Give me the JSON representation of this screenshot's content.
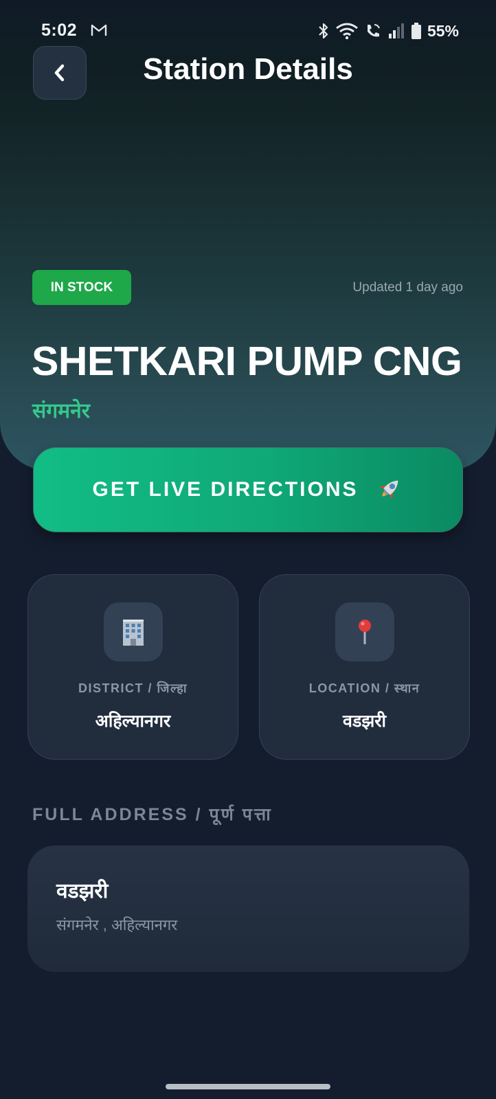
{
  "status_bar": {
    "time": "5:02",
    "battery": "55%",
    "icons": [
      "gmail-icon",
      "bluetooth-icon",
      "wifi-icon",
      "wifi-calling-icon",
      "cell-signal-icon",
      "battery-icon"
    ]
  },
  "header": {
    "back_icon": "chevron-left-icon",
    "title": "Station Details"
  },
  "station": {
    "stock_status": "IN STOCK",
    "updated": "Updated 1 day ago",
    "name": "SHETKARI PUMP CNG",
    "city": "संगमनेर"
  },
  "directions_button": {
    "label": "GET LIVE DIRECTIONS",
    "icon": "rocket-icon"
  },
  "cards": {
    "district": {
      "icon": "office-building-icon",
      "label": "DISTRICT / जिल्हा",
      "value": "अहिल्यानगर"
    },
    "location": {
      "icon": "map-pin-icon",
      "label": "LOCATION / स्थान",
      "value": "वडझरी"
    }
  },
  "address": {
    "heading": "FULL ADDRESS / पूर्ण पत्ता",
    "line1": "वडझरी",
    "line2": "संगमनेर , अहिल्यानगर"
  },
  "colors": {
    "background": "#141d2e",
    "accent_green": "#12bd85",
    "stock_badge": "#1ea84a",
    "city_text": "#34c98a",
    "card_bg": "#212c3d"
  }
}
